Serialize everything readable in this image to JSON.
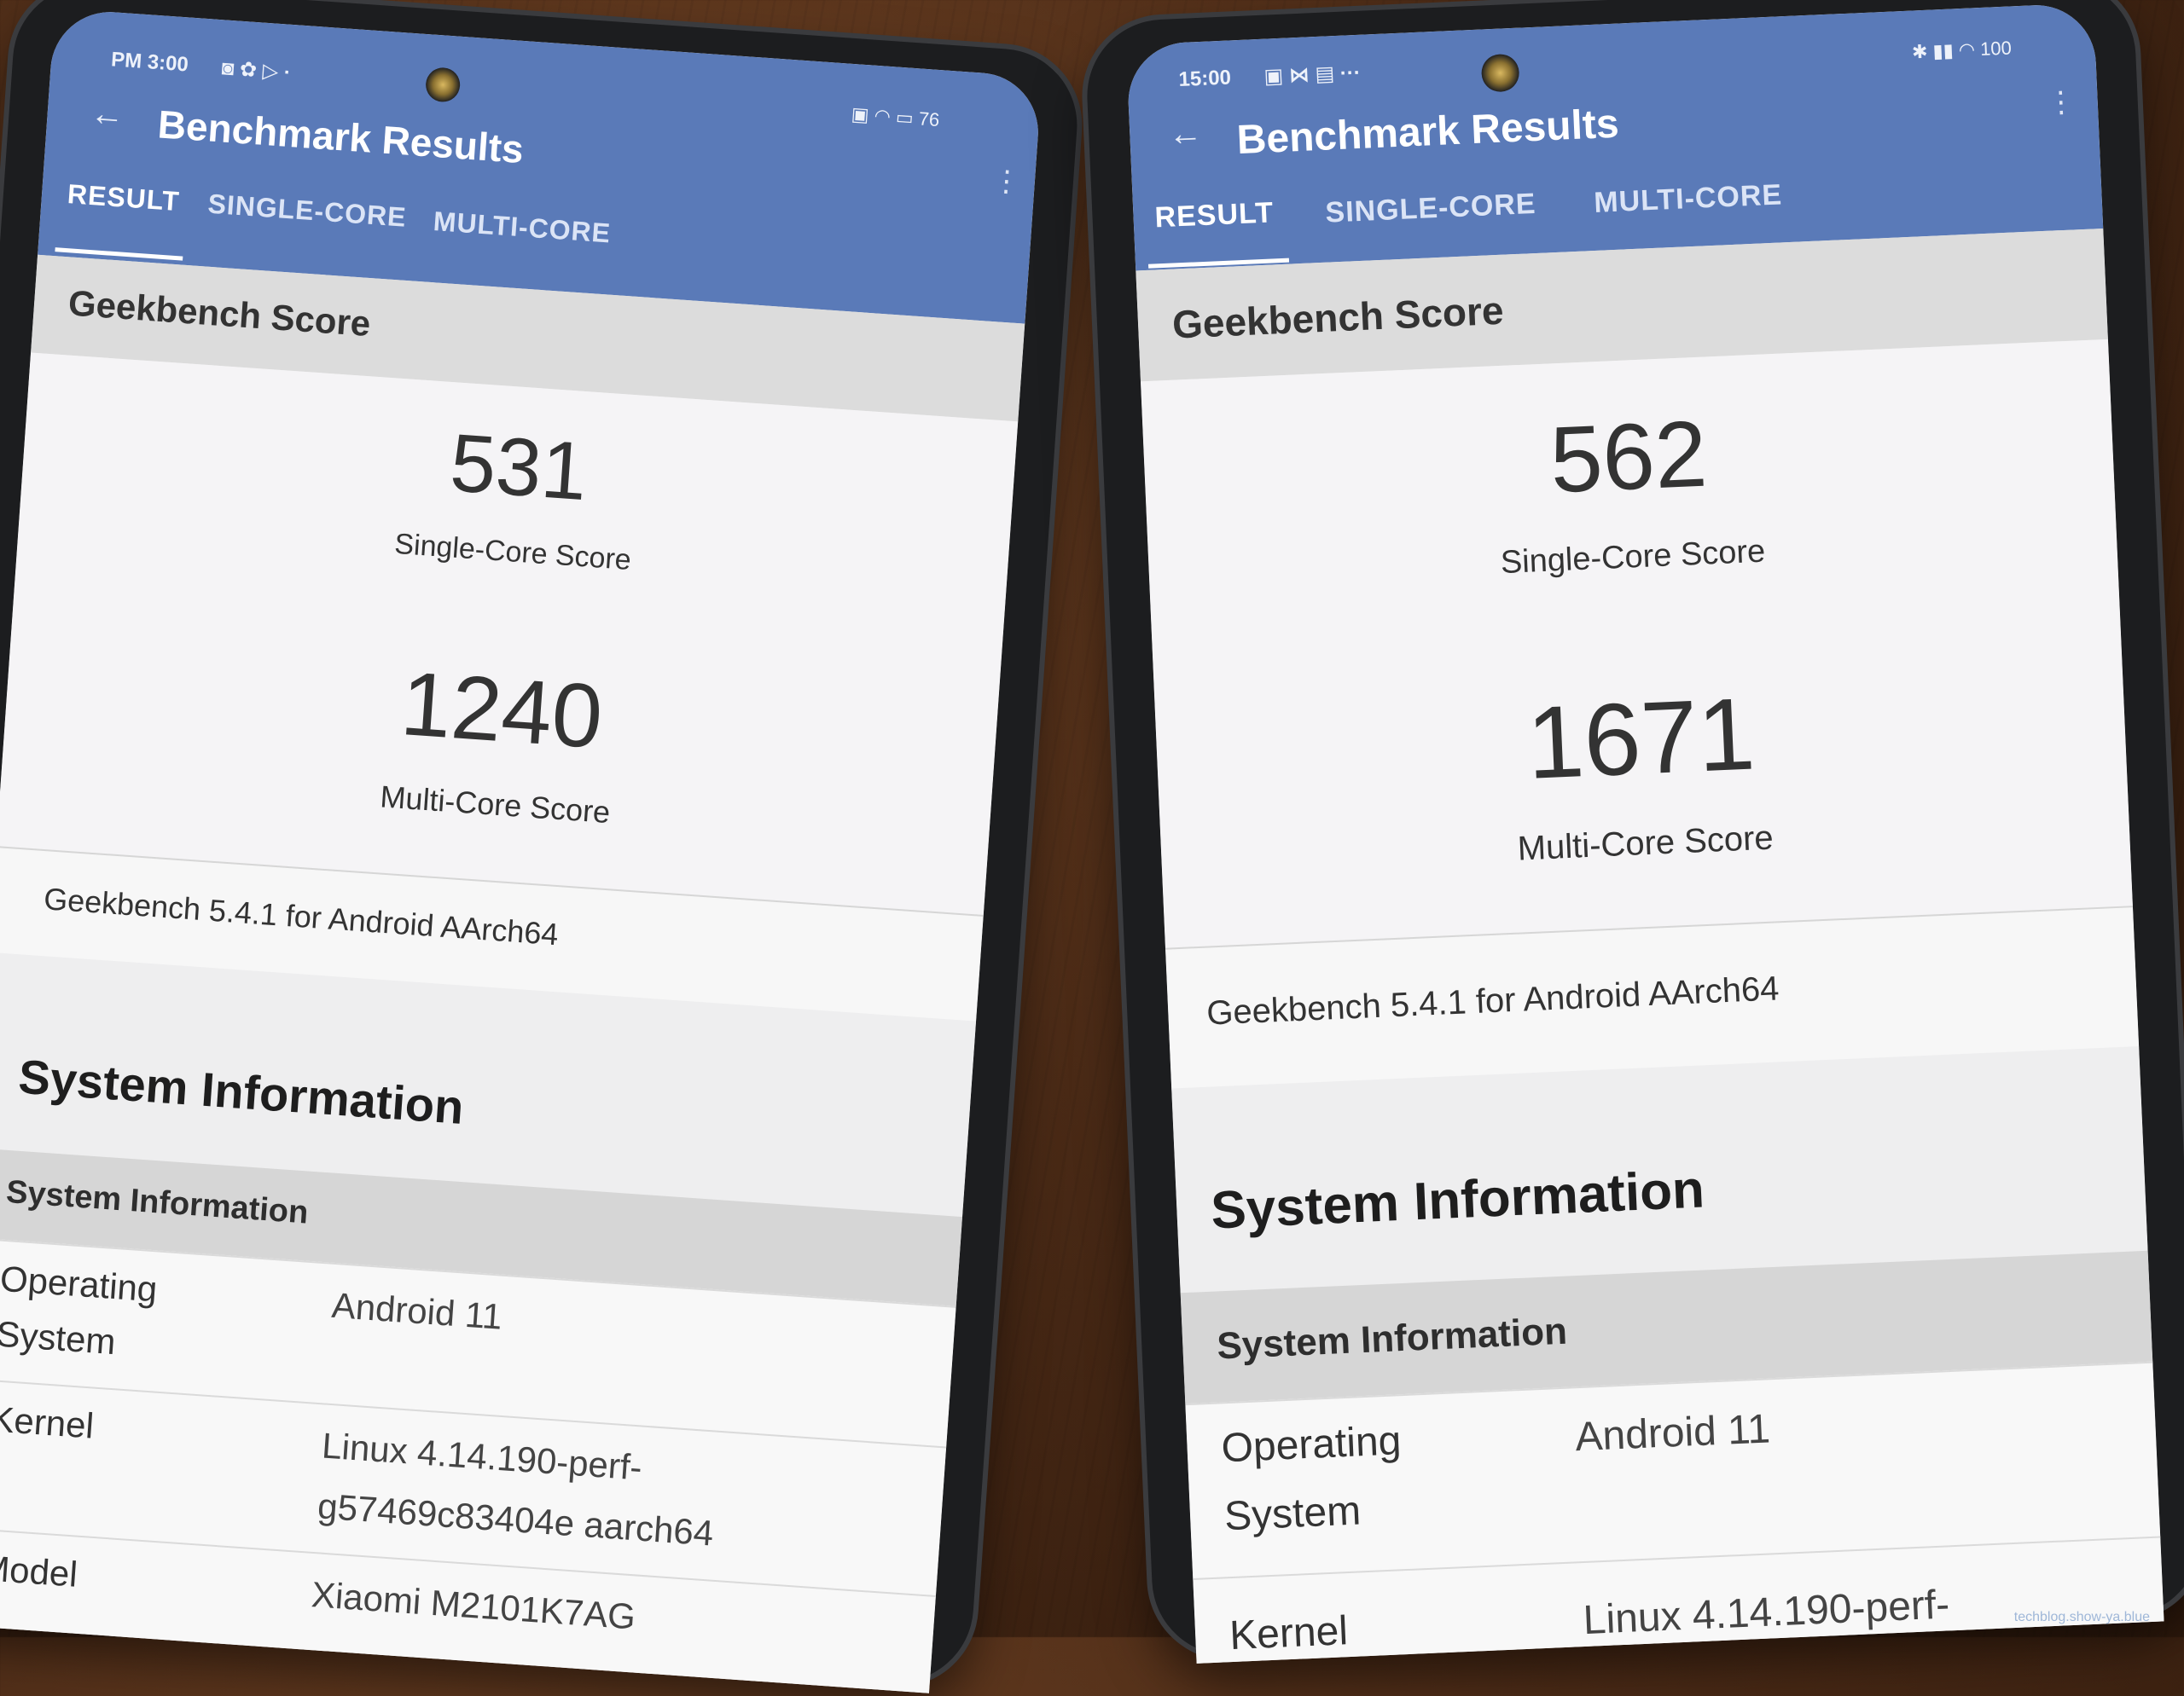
{
  "left_phone": {
    "status_time": "PM 3:00",
    "status_battery": "76",
    "title": "Benchmark Results",
    "tabs": [
      "RESULT",
      "SINGLE-CORE",
      "MULTI-CORE"
    ],
    "section_header": "Geekbench Score",
    "single_core_score": "531",
    "single_core_label": "Single-Core Score",
    "multi_core_score": "1240",
    "multi_core_label": "Multi-Core Score",
    "version": "Geekbench 5.4.1 for Android AArch64",
    "system_title": "System Information",
    "system_subheader": "System Information",
    "rows": [
      {
        "key_line1": "Operating",
        "key_line2": "System",
        "value_line1": "Android 11",
        "value_line2": ""
      },
      {
        "key_line1": "Kernel",
        "key_line2": "",
        "value_line1": "Linux 4.14.190-perf-",
        "value_line2": "g57469c83404e aarch64"
      },
      {
        "key_line1": "Model",
        "key_line2": "",
        "value_line1": "Xiaomi M2101K7AG",
        "value_line2": ""
      }
    ]
  },
  "right_phone": {
    "status_time": "15:00",
    "status_battery": "100",
    "title": "Benchmark Results",
    "tabs": [
      "RESULT",
      "SINGLE-CORE",
      "MULTI-CORE"
    ],
    "section_header": "Geekbench Score",
    "single_core_score": "562",
    "single_core_label": "Single-Core Score",
    "multi_core_score": "1671",
    "multi_core_label": "Multi-Core Score",
    "version": "Geekbench 5.4.1 for Android AArch64",
    "system_title": "System Information",
    "system_subheader": "System Information",
    "rows": [
      {
        "key_line1": "Operating",
        "key_line2": "System",
        "value_line1": "Android 11",
        "value_line2": ""
      },
      {
        "key_line1": "Kernel",
        "key_line2": "",
        "value_line1": "Linux 4.14.190-perf-",
        "value_line2": ""
      }
    ]
  },
  "watermark": "techblog.show-ya.blue",
  "colors": {
    "app_bar": "#5a7ab8",
    "wood": "#4a2a16",
    "screen_bg": "#ececec"
  }
}
